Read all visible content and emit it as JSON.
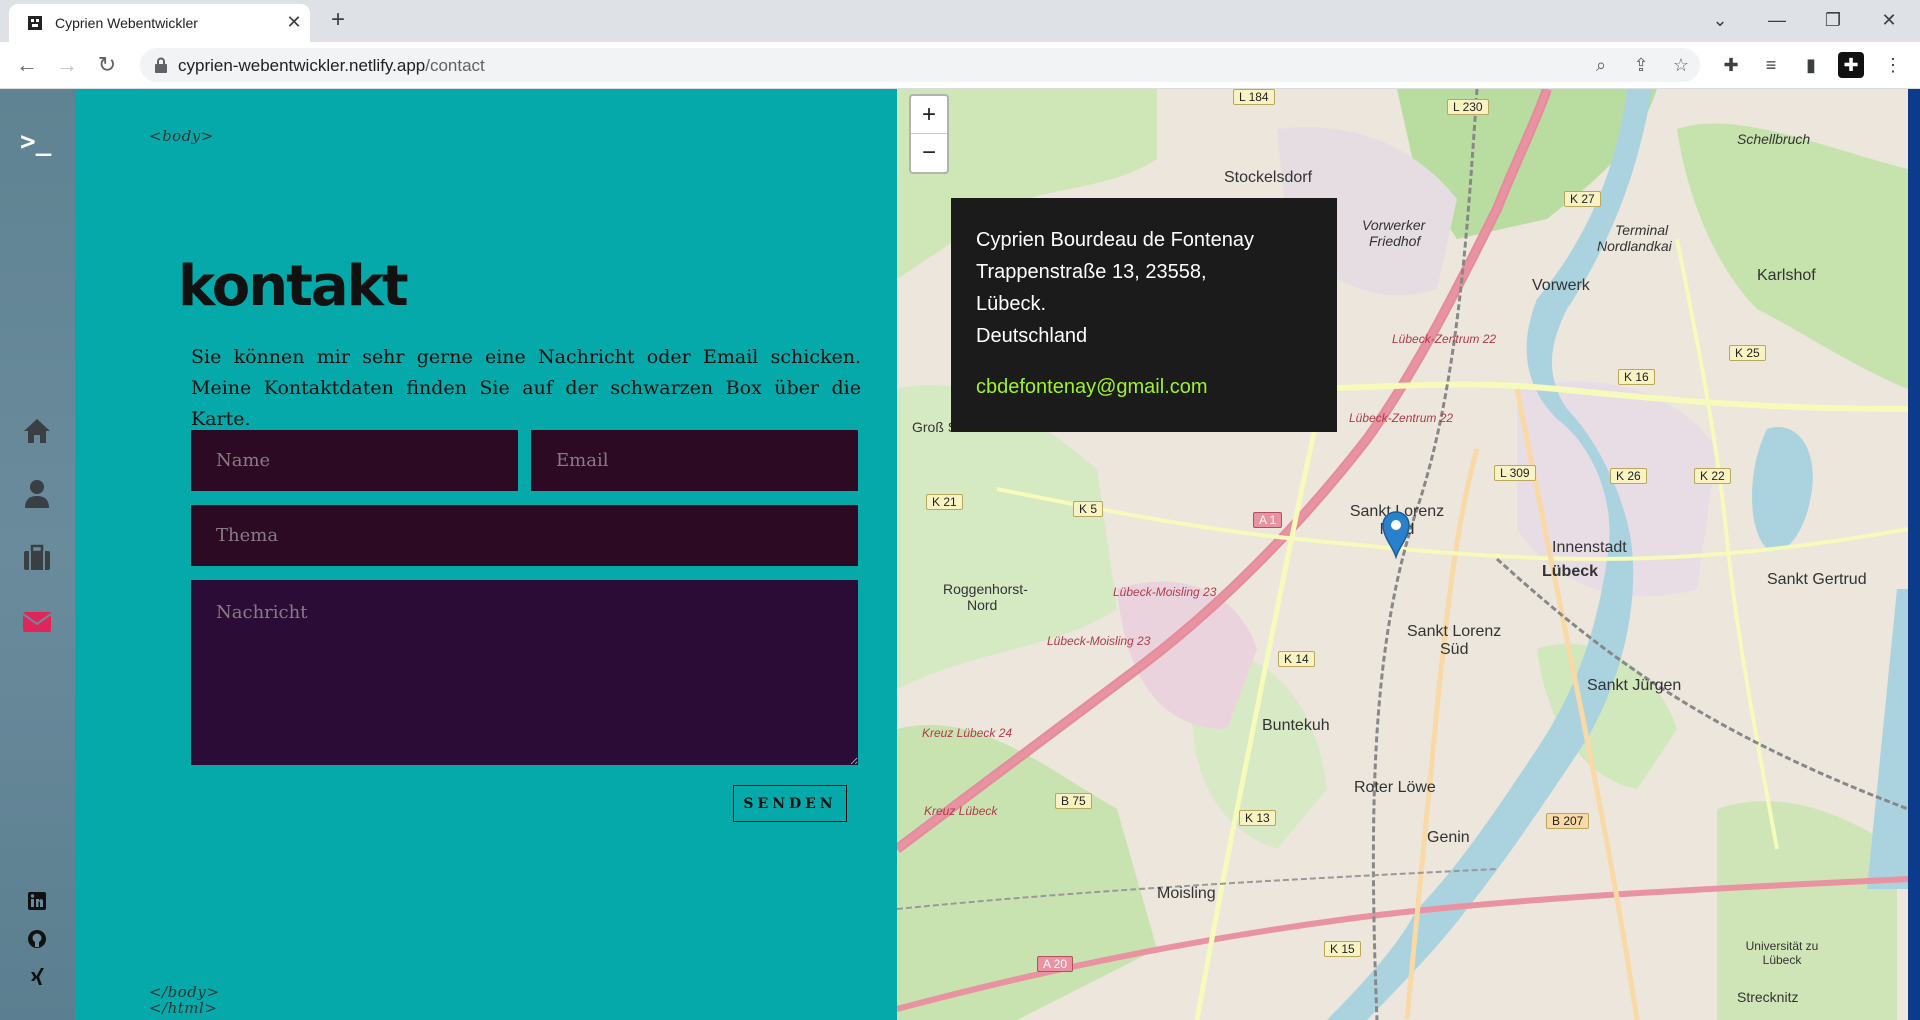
{
  "browser": {
    "tab_title": "Cyprien Webentwickler",
    "url_host": "cyprien-webentwickler.netlify.app",
    "url_path": "/contact",
    "new_tab_label": "+",
    "tab_close_label": "✕"
  },
  "sidebar": {
    "logo": ">_",
    "nav": [
      {
        "name": "home",
        "icon": "home-icon"
      },
      {
        "name": "about",
        "icon": "user-icon"
      },
      {
        "name": "portfolio",
        "icon": "briefcase-icon"
      },
      {
        "name": "contact",
        "icon": "envelope-icon",
        "active_color": "#e0255a"
      }
    ],
    "social": [
      {
        "name": "linkedin",
        "icon": "linkedin-icon"
      },
      {
        "name": "github",
        "icon": "github-icon"
      },
      {
        "name": "xing",
        "icon": "xing-icon"
      }
    ]
  },
  "content": {
    "body_open_tag": "<body>",
    "body_close_tag": "</body>",
    "html_close_tag": "</html>",
    "title": "kontakt",
    "intro": "Sie können mir sehr gerne eine Nachricht oder Email schicken. Meine Kontaktdaten finden Sie auf der schwarzen Box über die Karte.",
    "form": {
      "name_placeholder": "Name",
      "email_placeholder": "Email",
      "subject_placeholder": "Thema",
      "message_placeholder": "Nachricht",
      "send_label": "SENDEN"
    }
  },
  "map": {
    "zoom_in": "+",
    "zoom_out": "−",
    "info": {
      "name": "Cyprien Bourdeau de Fontenay",
      "street": "Trappenstraße 13, 23558,",
      "city": "Lübeck.",
      "country": "Deutschland",
      "email": "cbdefontenay@gmail.com"
    },
    "labels": {
      "stockelsdorf": "Stockelsdorf",
      "vorwerk": "Vorwerk",
      "karlshof": "Karlshof",
      "innenstadt": "Innenstadt",
      "luebeck": "Lübeck",
      "sankt_gertrud": "Sankt Gertrud",
      "sankt_lorenz_nord": "Sankt Lorenz Nord",
      "sankt_lorenz_sued_1": "Sankt Lorenz",
      "sankt_lorenz_sued_2": "Süd",
      "sankt_juergen": "Sankt Jürgen",
      "buntekuh": "Buntekuh",
      "roggenhorst_1": "Roggenhorst-",
      "roggenhorst_2": "Nord",
      "roter_lowe": "Roter Löwe",
      "genin": "Genin",
      "moisling": "Moisling",
      "vorwerker_friedhof_1": "Vorwerker",
      "vorwerker_friedhof_2": "Friedhof",
      "terminal_1": "Terminal",
      "terminal_2": "Nordlandkai",
      "schellbruch": "Schellbruch",
      "uni": "Universität zu Lübeck",
      "strecknitz": "Strecknitz",
      "gross_steinrade": "Groß Steinrade"
    },
    "roads": {
      "l184": "L 184",
      "l230": "L 230",
      "k27": "K 27",
      "k25": "K 25",
      "k16": "K 16",
      "l309": "L 309",
      "k26": "K 26",
      "k22": "K 22",
      "k21": "K 21",
      "k5": "K 5",
      "a1": "A 1",
      "k14": "K 14",
      "b75": "B 75",
      "k13": "K 13",
      "b207": "B 207",
      "a20": "A 20",
      "k15": "K 15"
    },
    "road_names": {
      "lz1": "Lübeck-Zentrum 22",
      "lz2": "Lübeck-Zentrum 22",
      "lm1": "Lübeck-Moisling 23",
      "lm2": "Lübeck-Moisling 23",
      "kl1": "Kreuz Lübeck 24",
      "kl2": "Kreuz Lübeck"
    },
    "colors": {
      "panel_bg": "#06a9a9",
      "input_bg": "#2d0a24",
      "info_bg": "#1b1b1b",
      "email_color": "#9ff22a",
      "accent": "#e0255a"
    }
  }
}
